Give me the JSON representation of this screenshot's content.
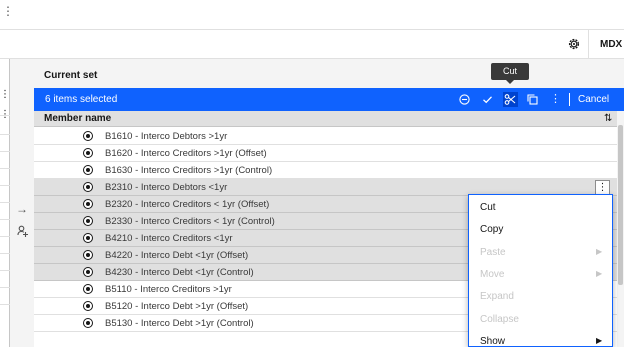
{
  "toolbar": {
    "mdx_label": "MDX",
    "settings_icon": "gear-icon"
  },
  "panel": {
    "current_set_label": "Current set"
  },
  "tooltip": {
    "text": "Cut"
  },
  "selection_bar": {
    "count_text": "6 items selected",
    "cancel_label": "Cancel",
    "icons": [
      "minus-circle-icon",
      "checkmark-icon",
      "scissors-icon",
      "copy-icon",
      "overflow-menu-icon"
    ],
    "accent_color": "#0f62fe"
  },
  "grid": {
    "column_header": "Member name",
    "rows": [
      {
        "label": "B1610 - Interco Debtors >1yr",
        "selected": false
      },
      {
        "label": "B1620 - Interco Creditors >1yr (Offset)",
        "selected": false
      },
      {
        "label": "B1630 - Interco Creditors >1yr (Control)",
        "selected": false
      },
      {
        "label": "B2310 - Interco Debtors <1yr",
        "selected": true
      },
      {
        "label": "B2320 - Interco Creditors < 1yr (Offset)",
        "selected": true
      },
      {
        "label": "B2330 - Interco Creditors < 1yr (Control)",
        "selected": true
      },
      {
        "label": "B4210 - Interco Creditors <1yr",
        "selected": true
      },
      {
        "label": "B4220 - Interco Debt <1yr (Offset)",
        "selected": true
      },
      {
        "label": "B4230 - Interco Debt <1yr (Control)",
        "selected": true
      },
      {
        "label": "B5110 - Interco Creditors >1yr",
        "selected": false
      },
      {
        "label": "B5120 - Interco Debt >1yr (Offset)",
        "selected": false
      },
      {
        "label": "B5130 - Interco Debt >1yr (Control)",
        "selected": false
      }
    ]
  },
  "context_menu": {
    "items": [
      {
        "label": "Cut",
        "enabled": true,
        "submenu": false
      },
      {
        "label": "Copy",
        "enabled": true,
        "submenu": false
      },
      {
        "label": "Paste",
        "enabled": false,
        "submenu": true
      },
      {
        "label": "Move",
        "enabled": false,
        "submenu": true
      },
      {
        "label": "Expand",
        "enabled": false,
        "submenu": false
      },
      {
        "label": "Collapse",
        "enabled": false,
        "submenu": false
      },
      {
        "label": "Show",
        "enabled": true,
        "submenu": true
      }
    ]
  }
}
